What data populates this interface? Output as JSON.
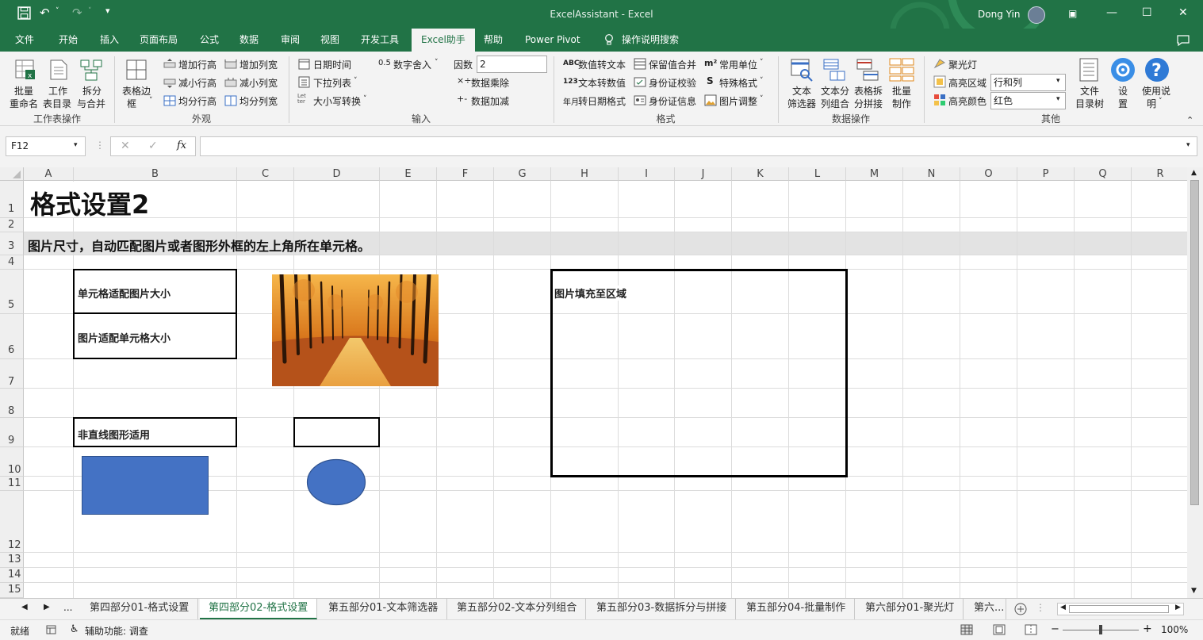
{
  "window": {
    "title": "ExcelAssistant  -  Excel",
    "user": "Dong Yin",
    "undo_icon": "undo-icon",
    "redo_icon": "redo-icon"
  },
  "menu": {
    "items": [
      "文件",
      "开始",
      "插入",
      "页面布局",
      "公式",
      "数据",
      "审阅",
      "视图",
      "开发工具",
      "Excel助手",
      "帮助",
      "Power Pivot",
      "操作说明搜索"
    ],
    "active": "Excel助手"
  },
  "ribbon": {
    "g1": {
      "b1": [
        "批量",
        "重命名"
      ],
      "b2": [
        "工作",
        "表目录"
      ],
      "b3": [
        "拆分",
        "与合并"
      ],
      "label": "工作表操作"
    },
    "g2": {
      "big": [
        "表格边",
        "框"
      ],
      "s1": "增加行高",
      "s2": "减小行高",
      "s3": "均分行高",
      "s4": "增加列宽",
      "s5": "减小列宽",
      "s6": "均分列宽",
      "label": "外观"
    },
    "g3": {
      "s1": "日期时间",
      "s2": "下拉列表",
      "s3": "大小写转换",
      "s4": "数字舍入",
      "s4_prefix": "0.5",
      "factor_label": "因数",
      "factor_value": "2",
      "s5": "数据乘除",
      "s6": "数据加减",
      "label": "输入"
    },
    "g4": {
      "s1": "数值转文本",
      "s2": "文本转数值",
      "s3": "转日期格式",
      "s4": "保留值合并",
      "s5": "身份证校验",
      "s6": "身份证信息",
      "s7": "常用单位",
      "s8": "特殊格式",
      "s9": "图片调整",
      "icon1": "ABC",
      "icon2": "123",
      "icon3": "年月",
      "icon7": "m²",
      "icon8": "S",
      "label": "格式"
    },
    "g5": {
      "b1": [
        "文本",
        "筛选器"
      ],
      "b2": [
        "文本分",
        "列组合"
      ],
      "b3": [
        "表格拆",
        "分拼接"
      ],
      "b4": [
        "批量",
        "制作"
      ],
      "label": "数据操作"
    },
    "g6": {
      "s1": "聚光灯",
      "s2": "高亮区域",
      "s3": "高亮颜色",
      "v2": "行和列",
      "v3": "红色",
      "b1": [
        "文件",
        "目录树"
      ],
      "b2": [
        "设",
        "置"
      ],
      "b3": [
        "使用说",
        "明"
      ],
      "label": "其他"
    }
  },
  "formula": {
    "namebox": "F12",
    "fx": "fx",
    "value": ""
  },
  "sheet": {
    "columns": [
      "A",
      "B",
      "C",
      "D",
      "E",
      "F",
      "G",
      "H",
      "I",
      "J",
      "K",
      "L",
      "M",
      "N",
      "O",
      "P",
      "Q",
      "R"
    ],
    "rows": [
      "1",
      "2",
      "3",
      "4",
      "5",
      "6",
      "7",
      "8",
      "9",
      "10",
      "11",
      "12",
      "13",
      "14",
      "15"
    ],
    "title": "格式设置2",
    "subtitle": "图片尺寸，自动匹配图片或者图形外框的左上角所在单元格。",
    "box1": "单元格适配图片大小",
    "box2": "图片适配单元格大小",
    "box3": "非直线图形适用",
    "box4": "图片填充至区域",
    "image": "autumn-forest-road-image",
    "shape_color": "#4472c4"
  },
  "tabs": {
    "items": [
      "第四部分01-格式设置",
      "第四部分02-格式设置",
      "第五部分01-文本筛选器",
      "第五部分02-文本分列组合",
      "第五部分03-数据拆分与拼接",
      "第五部分04-批量制作",
      "第六部分01-聚光灯",
      "第六..."
    ],
    "active": "第四部分02-格式设置",
    "nav": "..."
  },
  "status": {
    "ready": "就绪",
    "accessibility": "辅助功能: 调查",
    "zoom": "100%"
  },
  "colors": {
    "accent": "#217346",
    "sheet_bg": "#ffffff"
  }
}
